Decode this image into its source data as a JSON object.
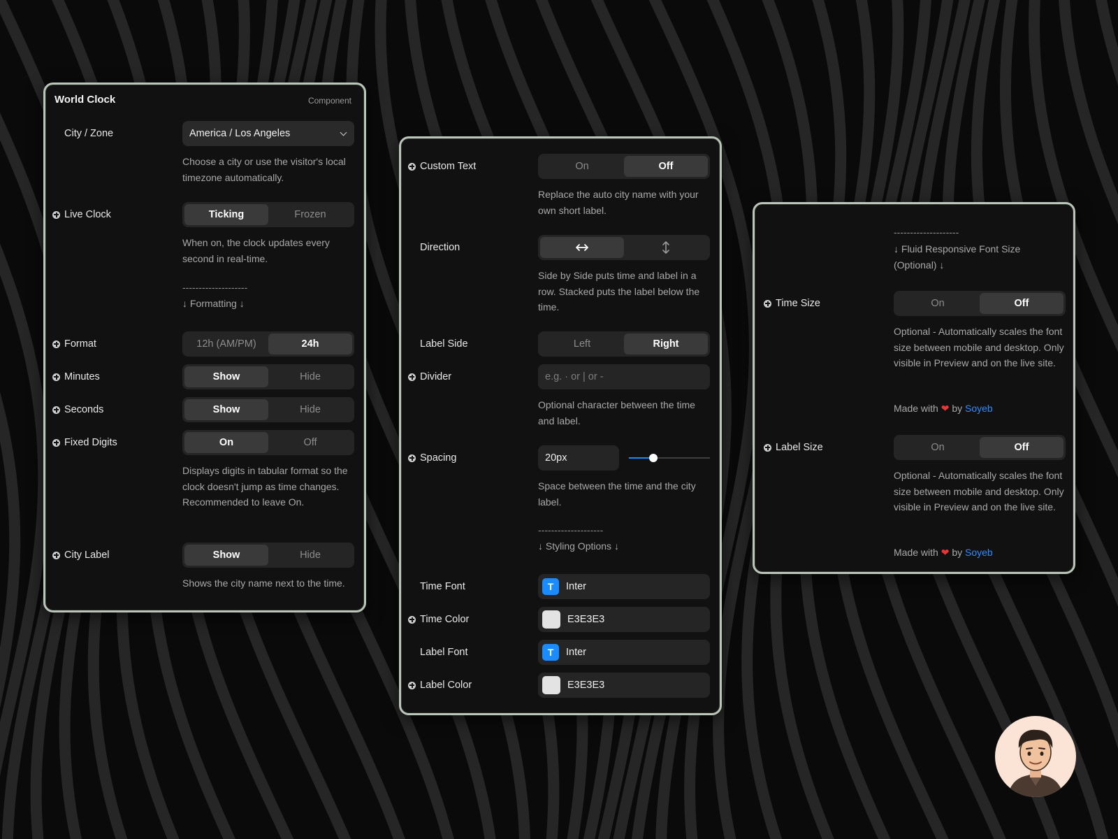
{
  "colors": {
    "panel_bg": "#111111",
    "panel_border": "#b9c6b9",
    "accent": "#1a8cff",
    "link": "#2d8cff",
    "heart": "#e53935"
  },
  "panel1": {
    "title": "World Clock",
    "badge": "Component",
    "city_zone": {
      "label": "City / Zone",
      "value": "America / Los Angeles",
      "desc": "Choose a city or use the visitor's local timezone automatically."
    },
    "live_clock": {
      "label": "Live Clock",
      "options": [
        "Ticking",
        "Frozen"
      ],
      "selected": "Ticking",
      "desc": "When on, the clock updates every second in real-time."
    },
    "formatting_divider": "--------------------",
    "formatting_title": "↓ Formatting ↓",
    "format": {
      "label": "Format",
      "options": [
        "12h (AM/PM)",
        "24h"
      ],
      "selected": "24h"
    },
    "minutes": {
      "label": "Minutes",
      "options": [
        "Show",
        "Hide"
      ],
      "selected": "Show"
    },
    "seconds": {
      "label": "Seconds",
      "options": [
        "Show",
        "Hide"
      ],
      "selected": "Show"
    },
    "fixed_digits": {
      "label": "Fixed Digits",
      "options": [
        "On",
        "Off"
      ],
      "selected": "On",
      "desc": "Displays digits in tabular format so the clock doesn't jump as time changes. Recommended to leave On."
    },
    "city_label": {
      "label": "City Label",
      "options": [
        "Show",
        "Hide"
      ],
      "selected": "Show",
      "desc": "Shows the city name next to the time."
    }
  },
  "panel2": {
    "custom_text": {
      "label": "Custom Text",
      "options": [
        "On",
        "Off"
      ],
      "selected": "Off",
      "desc": "Replace the auto city name with your own short label."
    },
    "direction": {
      "label": "Direction",
      "options": [
        "horizontal-arrows-icon",
        "vertical-arrows-icon"
      ],
      "selected": "horizontal-arrows-icon",
      "desc": "Side by Side puts time and label in a row. Stacked puts the label below the time."
    },
    "label_side": {
      "label": "Label Side",
      "options": [
        "Left",
        "Right"
      ],
      "selected": "Right"
    },
    "divider": {
      "label": "Divider",
      "placeholder": "e.g. · or | or -",
      "desc": "Optional character between the time and label."
    },
    "spacing": {
      "label": "Spacing",
      "value": "20px",
      "slider_fraction": 0.3,
      "desc": "Space between the time and the city label."
    },
    "styling_divider": "--------------------",
    "styling_title": "↓ Styling Options ↓",
    "time_font": {
      "label": "Time Font",
      "badge": "T",
      "value": "Inter"
    },
    "time_color": {
      "label": "Time Color",
      "value": "E3E3E3",
      "swatch": "#e3e3e3"
    },
    "label_font": {
      "label": "Label Font",
      "badge": "T",
      "value": "Inter"
    },
    "label_color": {
      "label": "Label Color",
      "value": "E3E3E3",
      "swatch": "#e3e3e3"
    }
  },
  "panel3": {
    "fluid_divider": "--------------------",
    "fluid_title": "↓ Fluid Responsive Font Size (Optional) ↓",
    "time_size": {
      "label": "Time Size",
      "options": [
        "On",
        "Off"
      ],
      "selected": "Off",
      "desc": "Optional - Automatically scales the font size between mobile and desktop. Only visible in Preview and on the live site."
    },
    "label_size": {
      "label": "Label Size",
      "options": [
        "On",
        "Off"
      ],
      "selected": "Off",
      "desc": "Optional - Automatically scales the font size between mobile and desktop. Only visible in Preview and on the live site."
    },
    "made_with": {
      "prefix": "Made with",
      "heart": "❤",
      "by": "by",
      "author": "Soyeb"
    }
  }
}
